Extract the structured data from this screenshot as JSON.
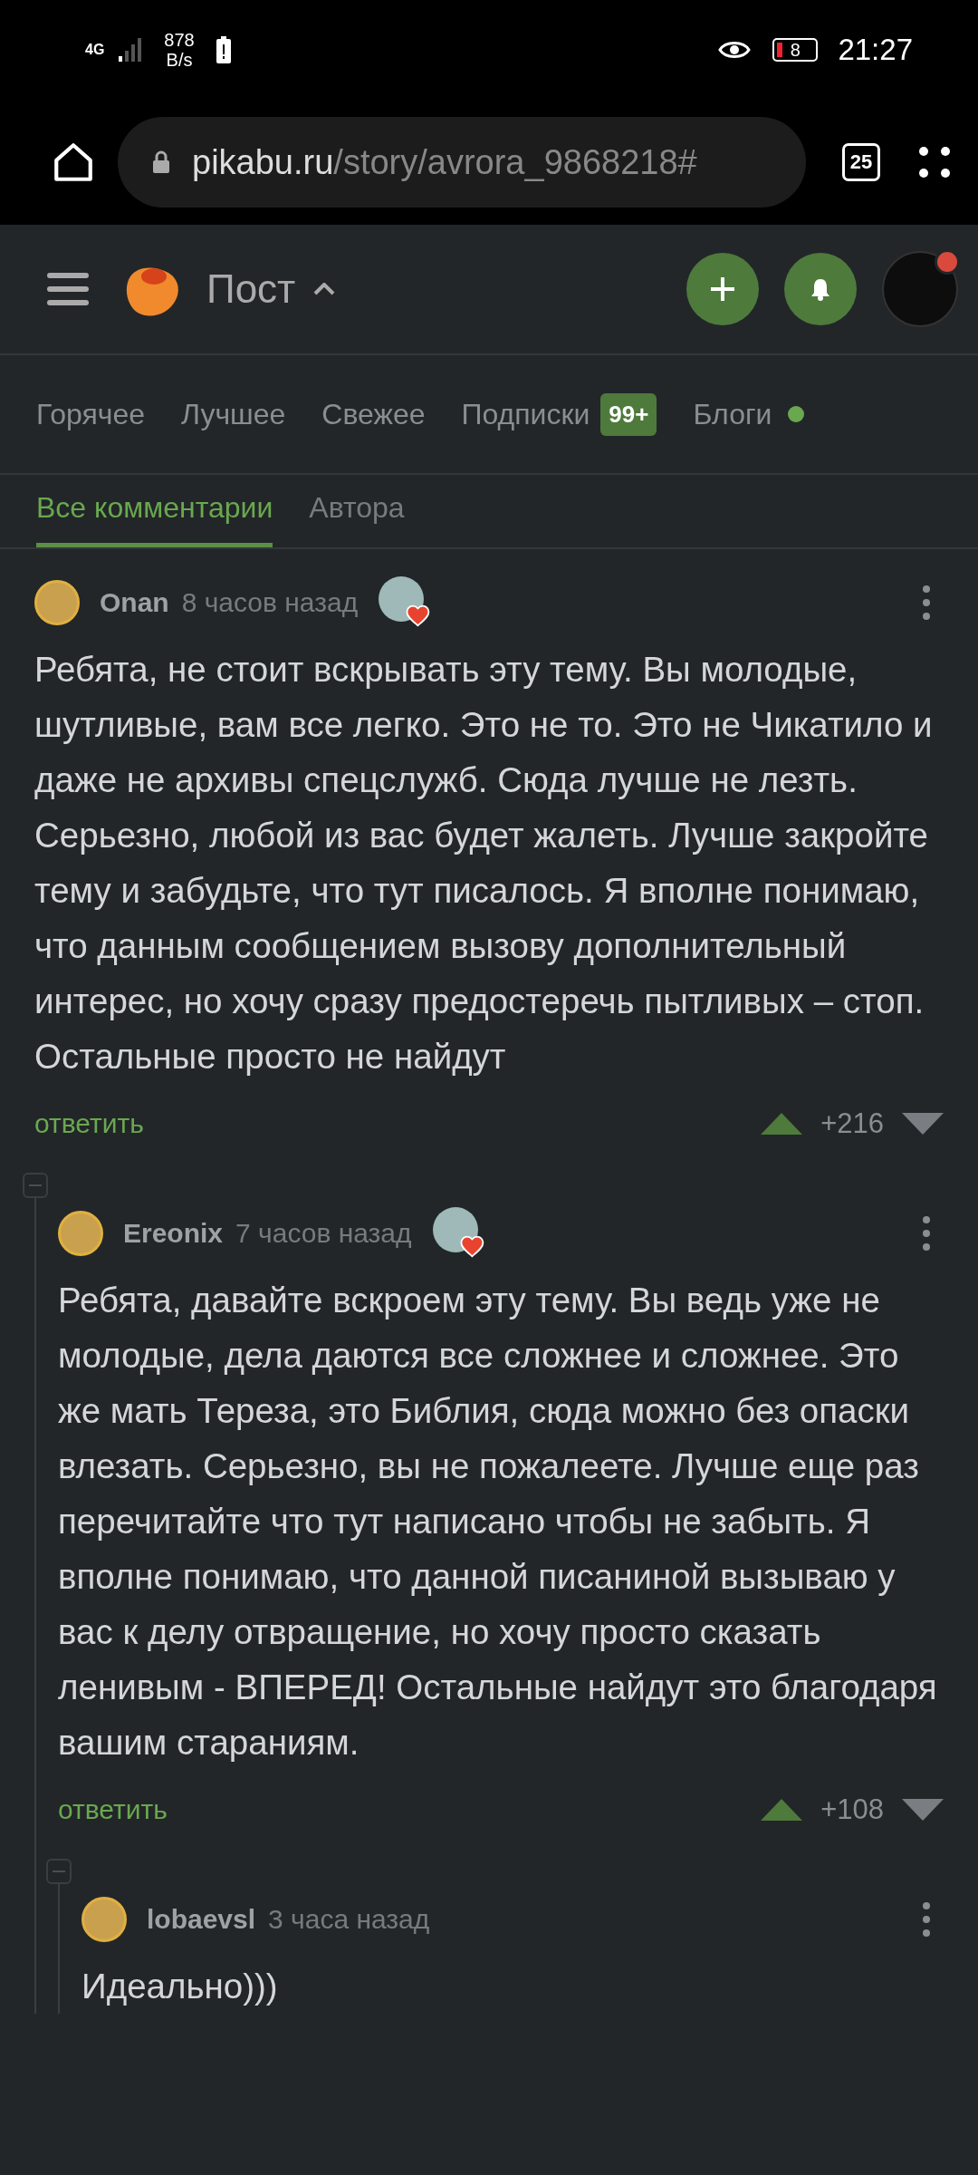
{
  "status_bar": {
    "network": "4G",
    "speed": "878",
    "speed_unit": "B/s",
    "battery": "8",
    "time": "21:27"
  },
  "url_bar": {
    "domain": "pikabu.ru",
    "path": "/story/avrora_9868218#",
    "tabs_count": "25"
  },
  "header": {
    "title": "Пост"
  },
  "nav": [
    {
      "label": "Горячее",
      "selected": false
    },
    {
      "label": "Лучшее",
      "selected": false
    },
    {
      "label": "Свежее",
      "selected": false
    },
    {
      "label": "Подписки",
      "selected": false,
      "badge": "99+"
    },
    {
      "label": "Блоги",
      "selected": false,
      "new_dot": true
    }
  ],
  "comment_tabs": [
    {
      "label": "Все комментарии",
      "selected": true
    },
    {
      "label": "Автора",
      "selected": false
    }
  ],
  "comments": [
    {
      "author": "Onan",
      "time": "8 часов назад",
      "award": true,
      "text": "Ребята, не стоит вскрывать эту тему. Вы молодые, шутливые, вам все легко. Это не то. Это не Чикатило и даже не архивы спецслужб. Сюда лучше не лезть. Серьезно, любой из вас будет жалеть. Лучше закройте тему и забудьте, что тут писалось. Я вполне понимаю, что данным сообщением вызову дополнительный интерес, но хочу сразу предостеречь пытливых – стоп. Остальные просто не найдут",
      "reply": "ответить",
      "rating": "+216",
      "children": [
        {
          "author": "Ereonix",
          "time": "7 часов назад",
          "award": true,
          "text": "Ребята, давайте вскроем эту тему. Вы ведь уже не молодые, дела даются все сложнее и сложнее. Это же мать Тереза, это Библия, сюда можно без опаски влезать. Серьезно, вы не пожалеете. Лучше еще раз перечитайте что тут написано чтобы не забыть. Я вполне понимаю, что данной писаниной вызываю у вас к делу отвращение, но хочу просто сказать ленивым - ВПЕРЕД! Остальные найдут это благодаря вашим стараниям.",
          "reply": "ответить",
          "rating": "+108",
          "children": [
            {
              "author": "lobaevsl",
              "time": "3 часа назад",
              "award": false,
              "text": "Идеально)))"
            }
          ]
        }
      ]
    }
  ]
}
